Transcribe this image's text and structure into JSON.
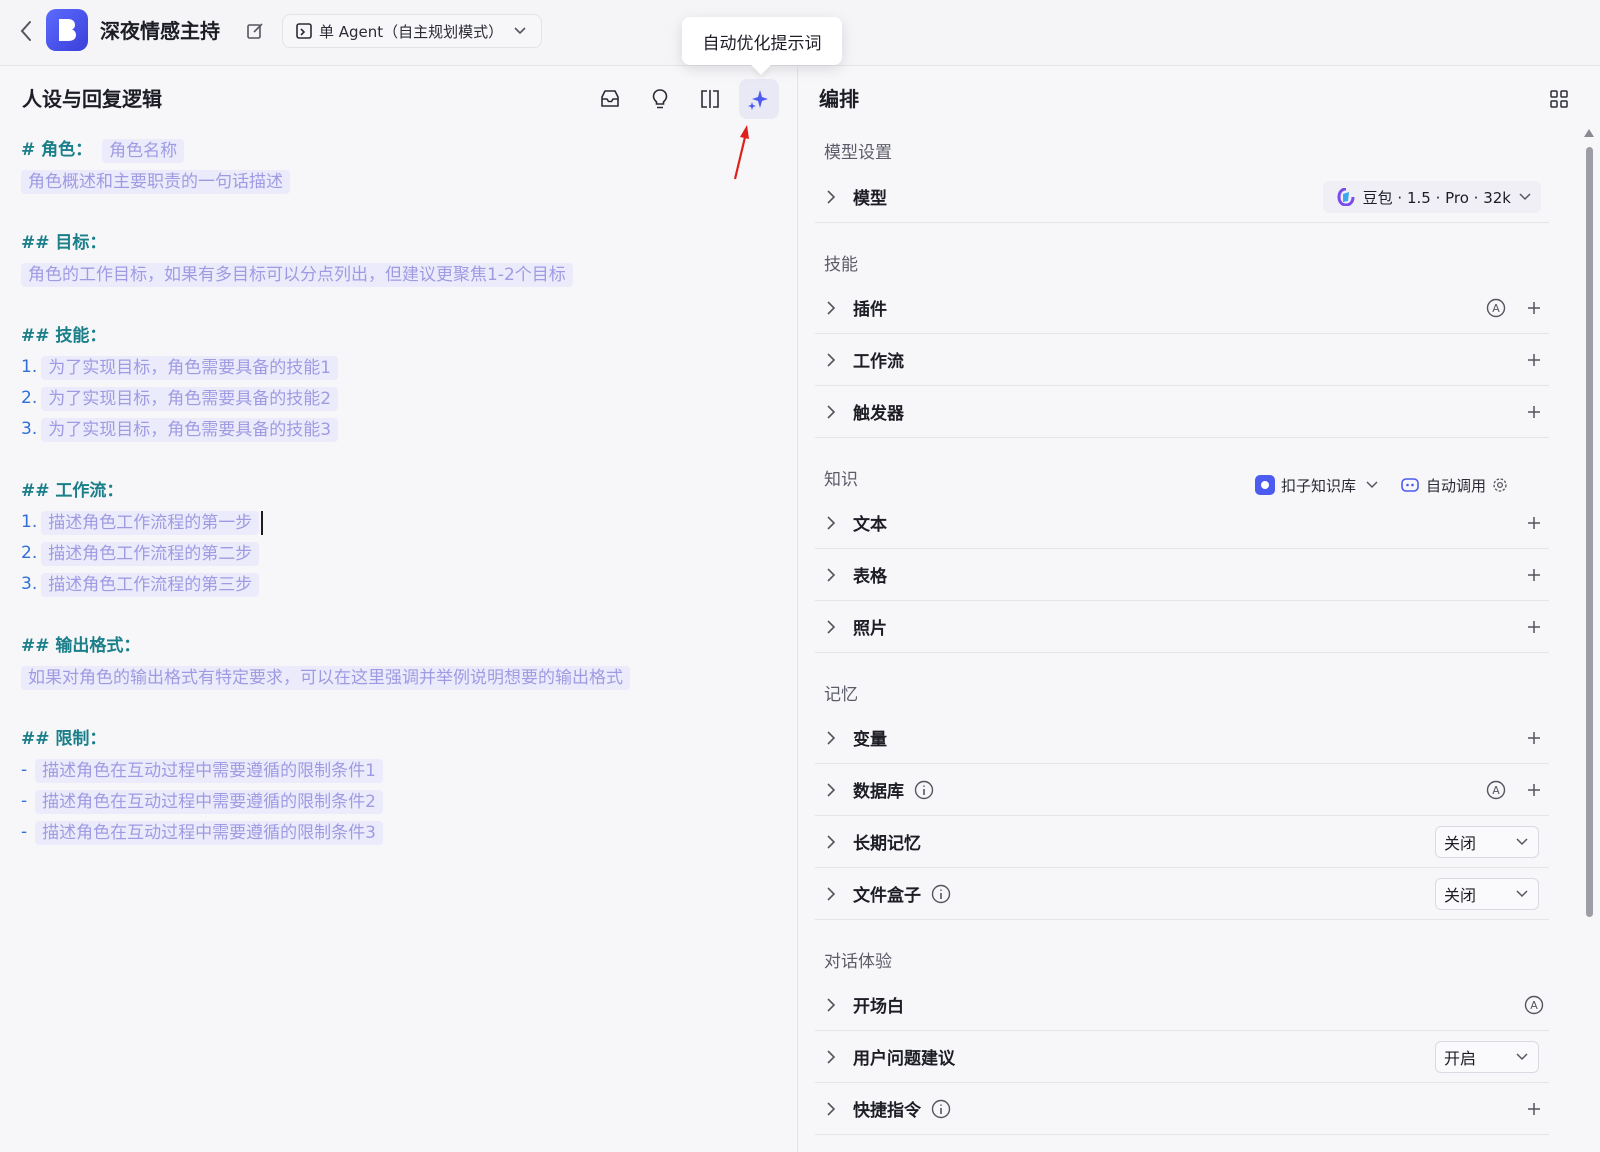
{
  "header": {
    "title": "深夜情感主持",
    "mode_label": "单 Agent（自主规划模式）",
    "tooltip": "自动优化提示词"
  },
  "left": {
    "title": "人设与回复逻辑",
    "prompt": {
      "role_heading": "# 角色：",
      "role_name_ph": "角色名称",
      "role_desc_ph": "角色概述和主要职责的一句话描述",
      "goal_heading": "## 目标：",
      "goal_ph": "角色的工作目标，如果有多目标可以分点列出，但建议更聚焦1-2个目标",
      "skill_heading": "## 技能：",
      "skills": [
        {
          "num": "1.",
          "text": "为了实现目标，角色需要具备的技能1"
        },
        {
          "num": "2.",
          "text": "为了实现目标，角色需要具备的技能2"
        },
        {
          "num": "3.",
          "text": "为了实现目标，角色需要具备的技能3"
        }
      ],
      "workflow_heading": "## 工作流：",
      "workflow": [
        {
          "num": "1.",
          "text": "描述角色工作流程的第一步"
        },
        {
          "num": "2.",
          "text": "描述角色工作流程的第二步"
        },
        {
          "num": "3.",
          "text": "描述角色工作流程的第三步"
        }
      ],
      "format_heading": "## 输出格式：",
      "format_ph": "如果对角色的输出格式有特定要求，可以在这里强调并举例说明想要的输出格式",
      "limit_heading": "## 限制：",
      "limits": [
        {
          "num": "-",
          "text": "描述角色在互动过程中需要遵循的限制条件1"
        },
        {
          "num": "-",
          "text": "描述角色在互动过程中需要遵循的限制条件2"
        },
        {
          "num": "-",
          "text": "描述角色在互动过程中需要遵循的限制条件3"
        }
      ]
    }
  },
  "right": {
    "title": "编排",
    "sections": {
      "model_settings": "模型设置",
      "skills": "技能",
      "knowledge": "知识",
      "memory": "记忆",
      "dialog": "对话体验"
    },
    "model": {
      "label": "模型",
      "value": "豆包 · 1.5 · Pro · 32k"
    },
    "plugin": "插件",
    "workflow": "工作流",
    "trigger": "触发器",
    "knowledge_base": "扣子知识库",
    "auto_call": "自动调用",
    "text": "文本",
    "table": "表格",
    "photo": "照片",
    "variable": "变量",
    "database": "数据库",
    "long_memory": {
      "label": "长期记忆",
      "value": "关闭"
    },
    "file_box": {
      "label": "文件盒子",
      "value": "关闭"
    },
    "opening": "开场白",
    "suggestion": {
      "label": "用户问题建议",
      "value": "开启"
    },
    "shortcut": "快捷指令"
  },
  "colors": {
    "accent": "#4c5cf0",
    "heading": "#1a7f88",
    "placeholder_bg": "#ecebfb",
    "placeholder_text": "#9f9be3"
  }
}
